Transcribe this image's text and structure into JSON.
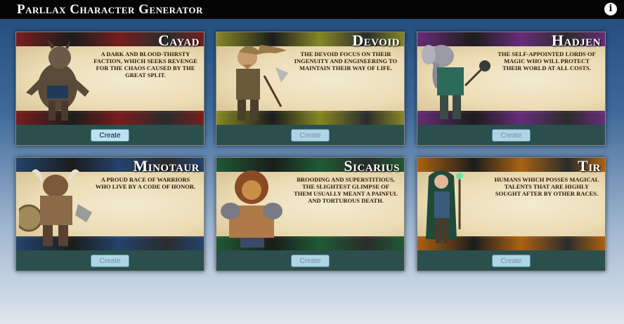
{
  "app": {
    "title": "Parllax Character Generator",
    "info_icon": "info-icon",
    "info_glyph": "i"
  },
  "factions": [
    {
      "name": "Cayad",
      "description": "A dark and blood-thirsty faction, which seeks revenge for the chaos caused by the great split.",
      "create_label": "Create",
      "create_enabled": true,
      "band_color": "#7a1b1b"
    },
    {
      "name": "Devoid",
      "description": "The Devoid focus on their ingenuity and engineering to maintain their way of life.",
      "create_label": "Create",
      "create_enabled": false,
      "band_color": "#8a8a22"
    },
    {
      "name": "Hadjen",
      "description": "The self-appointed lords of magic who will protect their world at all costs.",
      "create_label": "Create",
      "create_enabled": false,
      "band_color": "#6a2a7a"
    },
    {
      "name": "Minotaur",
      "description": "A proud race of warriors who live by a code of honor.",
      "create_label": "Create",
      "create_enabled": false,
      "band_color": "#23426f"
    },
    {
      "name": "Sicarius",
      "description": "Brooding and superstitious, the slightest glimpse of them usually meant a painful and torturous death.",
      "create_label": "Create",
      "create_enabled": false,
      "band_color": "#1e5a32"
    },
    {
      "name": "Tir",
      "description": "Humans which posses magical talents that are highly sought after by other races.",
      "create_label": "Create",
      "create_enabled": false,
      "band_color": "#b0620f"
    }
  ]
}
